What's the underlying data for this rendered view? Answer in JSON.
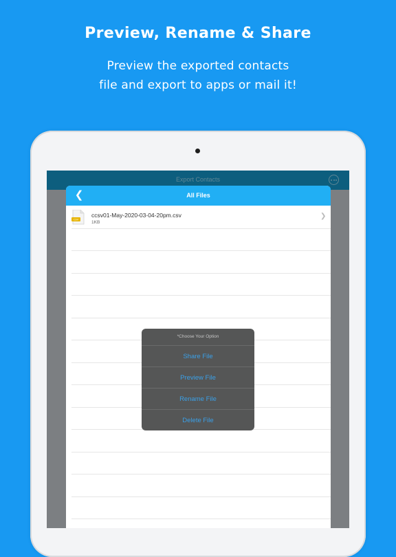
{
  "promo": {
    "headline": "Preview, Rename & Share",
    "subline_1": "Preview the exported contacts",
    "subline_2": "file and export to apps or mail it!"
  },
  "app_bar": {
    "title": "Export Contacts",
    "icon": "more-icon"
  },
  "files_sheet": {
    "title": "All Files",
    "back_icon": "chevron-left-icon",
    "files": [
      {
        "name": "ccsv01-May-2020-03-04-20pm.csv",
        "size": "1KB",
        "icon": "csv-file-icon"
      }
    ]
  },
  "action_dialog": {
    "title": "*Choose Your Option",
    "options": [
      "Share File",
      "Preview File",
      "Rename File",
      "Delete File"
    ]
  },
  "colors": {
    "background": "#1899f2",
    "header": "#21aff4",
    "app_bar": "#0d5e7e",
    "dialog_background": "#555656",
    "dialog_text": "#3ba0e7"
  }
}
